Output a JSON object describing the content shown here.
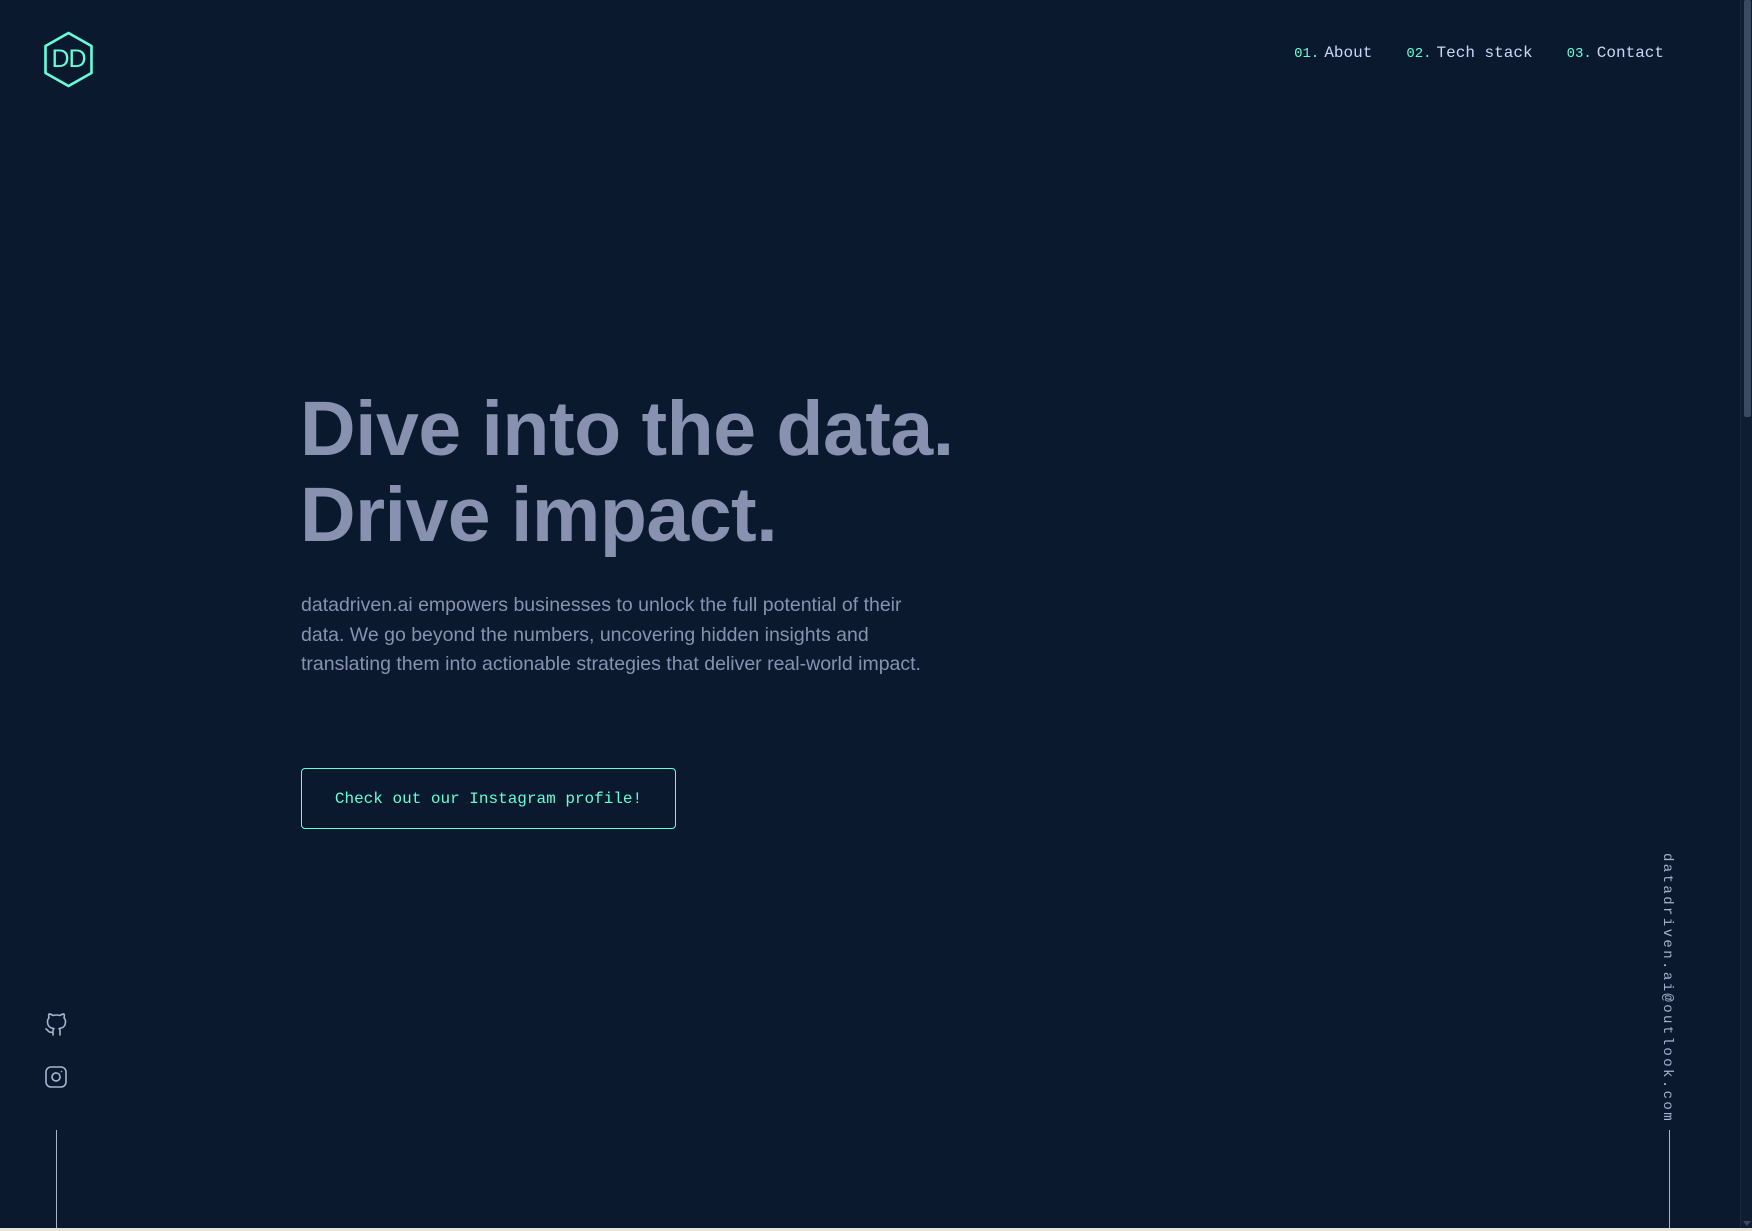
{
  "logo": {
    "text": "DD",
    "icon": "hexagon-logo-icon",
    "accent": "#64ffda"
  },
  "nav": {
    "items": [
      {
        "number": "01.",
        "label": "About"
      },
      {
        "number": "02.",
        "label": "Tech stack"
      },
      {
        "number": "03.",
        "label": "Contact"
      }
    ]
  },
  "hero": {
    "headline_line1": "Dive into the data.",
    "headline_line2": "Drive impact.",
    "description": "datadriven.ai empowers businesses to unlock the full potential of their data. We go beyond the numbers, uncovering hidden insights and translating them into actionable strategies that deliver real-world impact.",
    "cta_label": "Check out our Instagram profile!"
  },
  "social": {
    "icons": [
      "github-icon",
      "instagram-icon"
    ]
  },
  "email": {
    "address": "datadriven.ai@outlook.com"
  },
  "colors": {
    "background": "#0b192f",
    "accent": "#64ffda",
    "text_light": "#ccd6f6",
    "text_muted": "#8892b0"
  }
}
